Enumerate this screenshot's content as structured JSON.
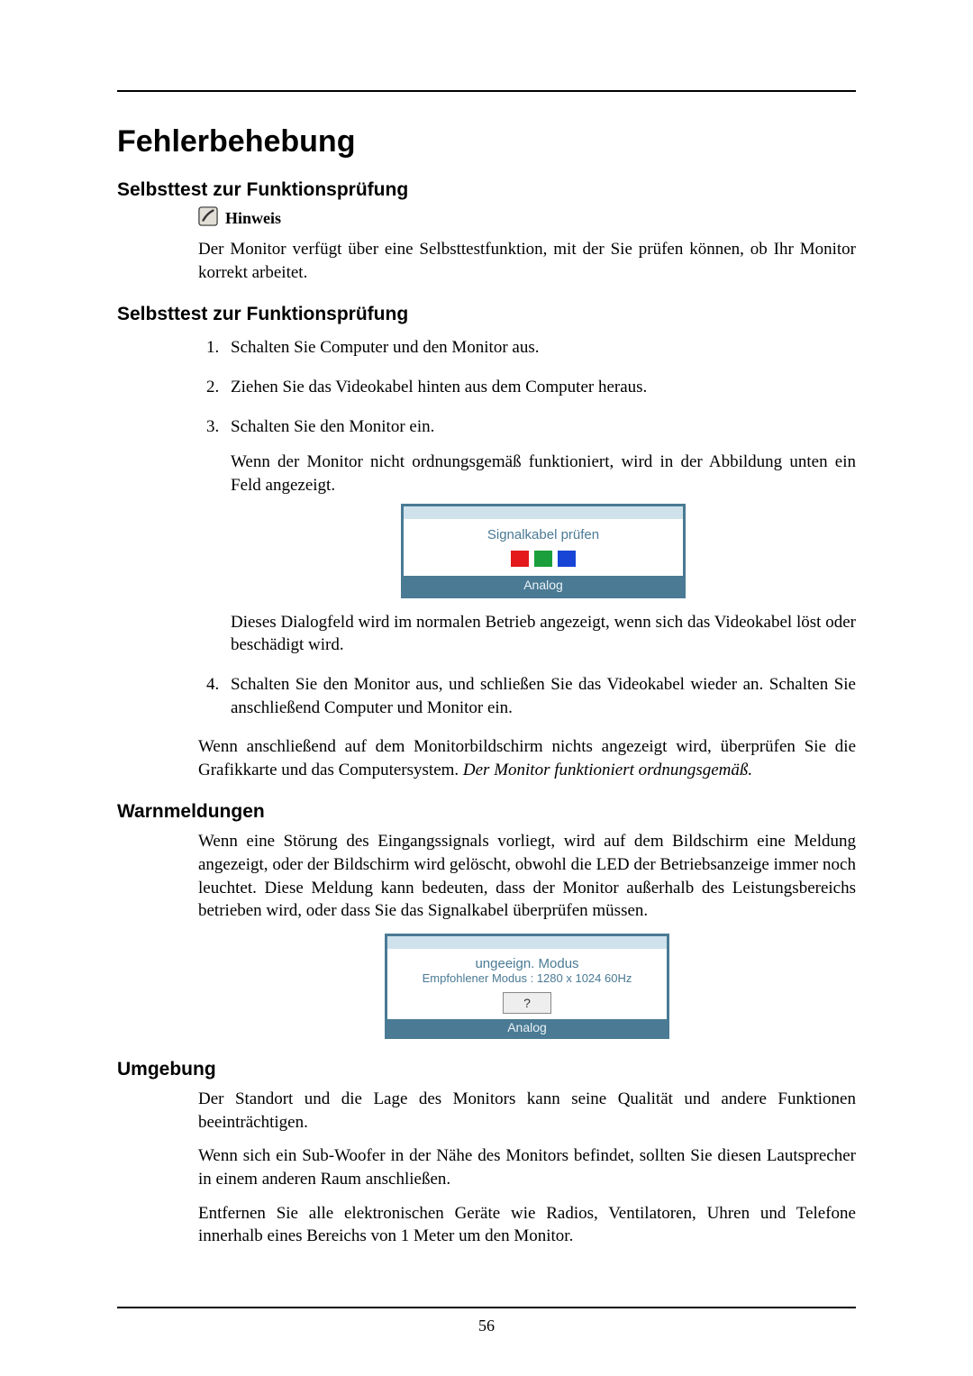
{
  "page_number": "56",
  "h1": "Fehlerbehebung",
  "section1": {
    "heading": "Selbsttest zur Funktionsprüfung",
    "note_label": "Hinweis",
    "note_text": "Der Monitor verfügt über eine Selbsttestfunktion, mit der Sie prüfen können, ob Ihr Monitor korrekt arbeitet."
  },
  "section2": {
    "heading": "Selbsttest zur Funktionsprüfung",
    "items": [
      "Schalten Sie Computer und den Monitor aus.",
      "Ziehen Sie das Videokabel hinten aus dem Computer heraus.",
      "Schalten Sie den Monitor ein.",
      "Schalten Sie den Monitor aus, und schließen Sie das Videokabel wieder an. Schalten Sie anschließend Computer und Monitor ein."
    ],
    "step3_para1": "Wenn der Monitor nicht ordnungsgemäß funktioniert, wird in der Abbildung unten ein Feld angezeigt.",
    "osd1": {
      "message": "Signalkabel prüfen",
      "footer": "Analog"
    },
    "step3_para2": "Dieses Dialogfeld wird im normalen Betrieb angezeigt, wenn sich das Videokabel löst oder beschädigt wird.",
    "closing_para": "Wenn anschließend auf dem Monitorbildschirm nichts angezeigt wird, überprüfen Sie die Grafikkarte und das Computersystem. ",
    "closing_italic": "Der Monitor funktioniert ordnungsgemäß."
  },
  "section3": {
    "heading": "Warnmeldungen",
    "para": "Wenn eine Störung des Eingangssignals vorliegt, wird auf dem Bildschirm eine Meldung angezeigt, oder der Bildschirm wird gelöscht, obwohl die LED der Betriebsanzeige immer noch leuchtet. Diese Meldung kann bedeuten, dass der Monitor außerhalb des Leistungsbereichs betrieben wird, oder dass Sie das Signalkabel überprüfen müssen.",
    "osd2": {
      "line1": "ungeeign. Modus",
      "line2": "Empfohlener Modus : 1280 x 1024  60Hz",
      "qmark": "?",
      "footer": "Analog"
    }
  },
  "section4": {
    "heading": "Umgebung",
    "p1": "Der Standort und die Lage des Monitors kann seine Qualität und andere Funktionen beeinträchtigen.",
    "p2": "Wenn sich ein Sub-Woofer in der Nähe des Monitors befindet, sollten Sie diesen Lautsprecher in einem anderen Raum anschließen.",
    "p3": "Entfernen Sie alle elektronischen Geräte wie Radios, Ventilatoren, Uhren und Telefone innerhalb eines Bereichs von 1 Meter um den Monitor."
  }
}
